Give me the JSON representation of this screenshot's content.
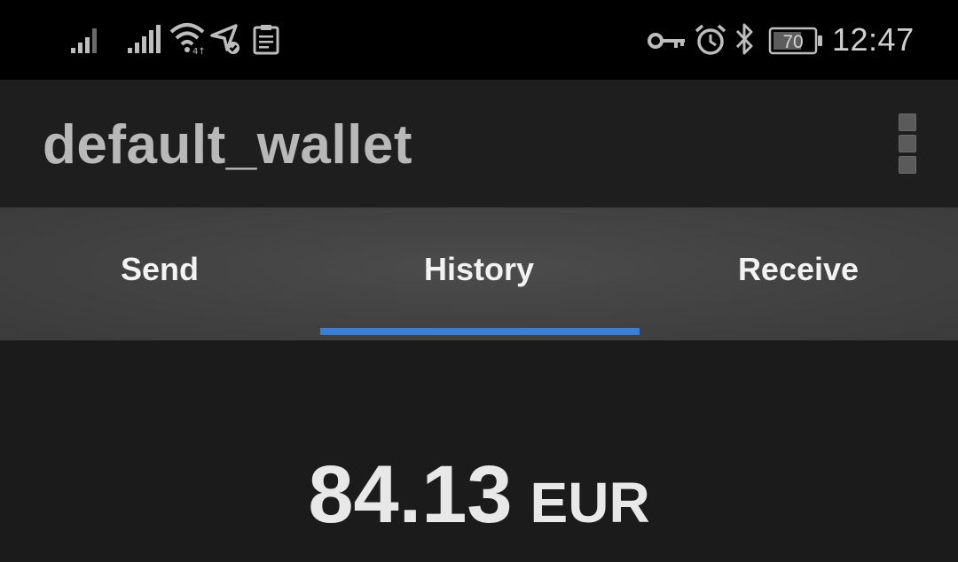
{
  "status_bar": {
    "time": "12:47",
    "battery_level": "70",
    "icons": [
      "signal-icon",
      "signal-icon",
      "wifi-icon",
      "location-icon",
      "clipboard-icon",
      "vpn-key-icon",
      "alarm-icon",
      "bluetooth-icon",
      "battery-icon"
    ]
  },
  "app_bar": {
    "title": "default_wallet",
    "menu_icon": "overflow-menu-icon"
  },
  "tabs": [
    {
      "label": "Send"
    },
    {
      "label": "History"
    },
    {
      "label": "Receive"
    }
  ],
  "selected_tab": "History",
  "colors": {
    "accent": "#3a7fd5",
    "background": "#1c1c1c",
    "tab_bar": "#444444"
  },
  "balance": {
    "amount": "84.13",
    "currency": "EUR"
  }
}
